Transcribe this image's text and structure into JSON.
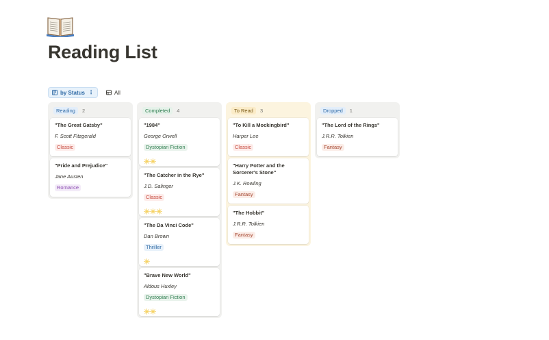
{
  "page": {
    "icon": "open-book-icon",
    "title": "Reading List"
  },
  "views": [
    {
      "label": "by Status",
      "icon": "board-icon",
      "active": true
    },
    {
      "label": "All",
      "icon": "table-icon",
      "active": false
    }
  ],
  "colors": {
    "Reading": {
      "label_bg": "#e3eefa",
      "label_fg": "#2f6aa5",
      "column_bg": "#f1f1ef"
    },
    "Completed": {
      "label_bg": "#e6f2ea",
      "label_fg": "#2e7d4f",
      "column_bg": "#f1f1ef"
    },
    "To Read": {
      "label_bg": "#fbecc8",
      "label_fg": "#7a5a17",
      "column_bg": "#fcf4df"
    },
    "Dropped": {
      "label_bg": "#e3eefa",
      "label_fg": "#2f6aa5",
      "column_bg": "#f1f1ef"
    },
    "genres": {
      "Classic": {
        "fg": "#c4463a",
        "bg": "#fdecea"
      },
      "Romance": {
        "fg": "#8b4bb0",
        "bg": "#f3ebf8"
      },
      "Dystopian Fiction": {
        "fg": "#2e7d4f",
        "bg": "#e9f3ec"
      },
      "Thriller": {
        "fg": "#2f6aa5",
        "bg": "#e8f1fa"
      },
      "Fantasy": {
        "fg": "#a4452e",
        "bg": "#fbede8"
      }
    }
  },
  "columns": [
    {
      "label": "Reading",
      "count": "2",
      "cards": [
        {
          "title": "\"The Great Gatsby\"",
          "author": "F. Scott Fitzgerald",
          "genre": "Classic",
          "rating": 0
        },
        {
          "title": "\"Pride and Prejudice\"",
          "author": "Jane Austen",
          "genre": "Romance",
          "rating": 0
        }
      ]
    },
    {
      "label": "Completed",
      "count": "4",
      "cards": [
        {
          "title": "\"1984\"",
          "author": "George Orwell",
          "genre": "Dystopian Fiction",
          "rating": 2
        },
        {
          "title": "\"The Catcher in the Rye\"",
          "author": "J.D. Salinger",
          "genre": "Classic",
          "rating": 3
        },
        {
          "title": "\"The Da Vinci Code\"",
          "author": "Dan Brown",
          "genre": "Thriller",
          "rating": 1
        },
        {
          "title": "\"Brave New World\"",
          "author": "Aldous Huxley",
          "genre": "Dystopian Fiction",
          "rating": 2
        }
      ]
    },
    {
      "label": "To Read",
      "count": "3",
      "cards": [
        {
          "title": "\"To Kill a Mockingbird\"",
          "author": "Harper Lee",
          "genre": "Classic",
          "rating": 0
        },
        {
          "title": "\"Harry Potter and the Sorcerer's Stone\"",
          "author": "J.K. Rowling",
          "genre": "Fantasy",
          "rating": 0
        },
        {
          "title": "\"The Hobbit\"",
          "author": "J.R.R. Tolkien",
          "genre": "Fantasy",
          "rating": 0
        }
      ]
    },
    {
      "label": "Dropped",
      "count": "1",
      "cards": [
        {
          "title": "\"The Lord of the Rings\"",
          "author": "J.R.R. Tolkien",
          "genre": "Fantasy",
          "rating": 0
        }
      ]
    }
  ]
}
